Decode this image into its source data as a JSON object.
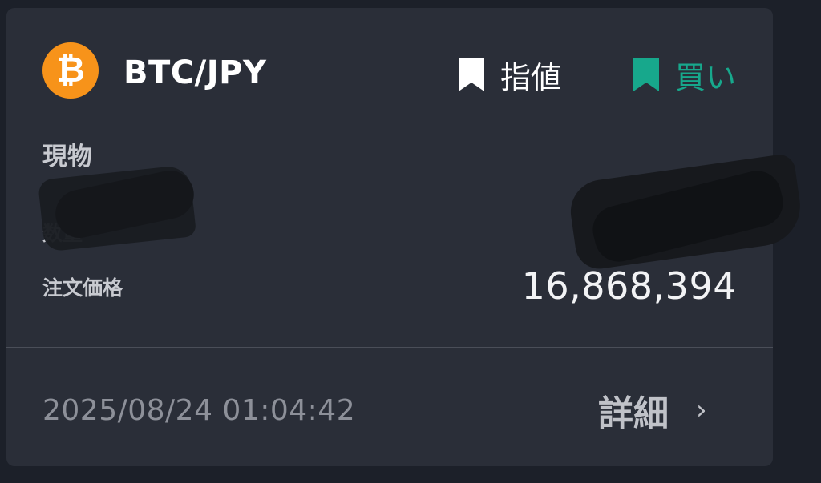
{
  "header": {
    "coin_icon_glyph": "₿",
    "coin_icon_name": "bitcoin-icon",
    "coin_color": "#f7931a",
    "pair": "BTC/JPY",
    "order_kind_tag": {
      "icon": "bookmark-icon",
      "label": "指値",
      "color": "#ffffff"
    },
    "side_tag": {
      "icon": "bookmark-icon",
      "label": "買い",
      "color": "#17a88c"
    }
  },
  "body": {
    "order_type": "現物",
    "quantity_label": "数量",
    "price_label": "注文価格",
    "price_value": "16,868,394"
  },
  "footer": {
    "timestamp": "2025/08/24 01:04:42",
    "details_label": "詳細",
    "chevron_glyph": "›"
  }
}
